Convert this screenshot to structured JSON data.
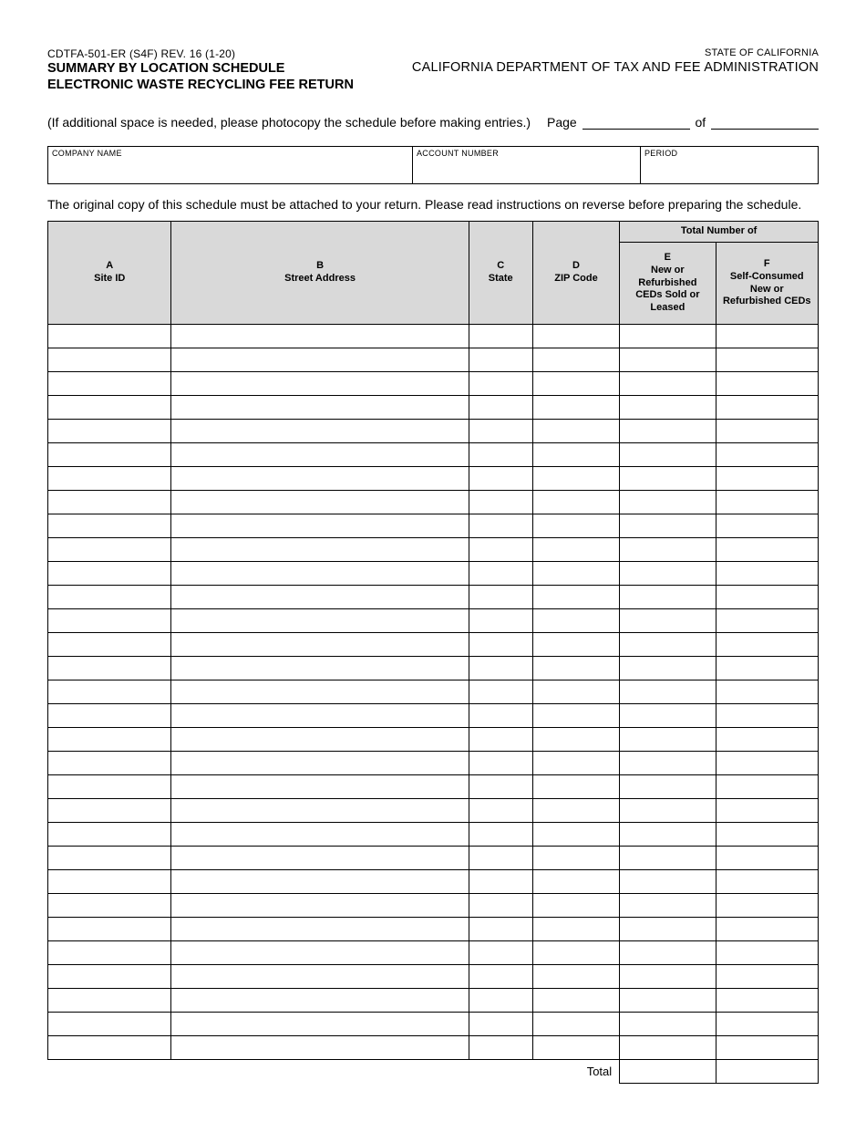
{
  "header": {
    "form_id": "CDTFA-501-ER (S4F) REV. 16 (1-20)",
    "title_line1": "SUMMARY BY LOCATION SCHEDULE",
    "title_line2": "ELECTRONIC WASTE RECYCLING FEE RETURN",
    "state": "STATE OF CALIFORNIA",
    "department": "CALIFORNIA DEPARTMENT OF TAX AND FEE ADMINISTRATION"
  },
  "instructions": {
    "photocopy": "(If additional space is needed, please photocopy the schedule before making entries.)",
    "page_label": "Page",
    "of_label": "of",
    "attach_note": "The original copy of this schedule must be attached to your return. Please read instructions on reverse before preparing the schedule."
  },
  "page_of": {
    "page": "",
    "total": ""
  },
  "info_box": {
    "company_label": "COMPANY NAME",
    "account_label": "ACCOUNT NUMBER",
    "period_label": "PERIOD",
    "company_value": "",
    "account_value": "",
    "period_value": ""
  },
  "schedule": {
    "super_header": "Total Number of",
    "columns": {
      "a": {
        "letter": "A",
        "label": "Site ID"
      },
      "b": {
        "letter": "B",
        "label": "Street Address"
      },
      "c": {
        "letter": "C",
        "label": "State"
      },
      "d": {
        "letter": "D",
        "label": "ZIP Code"
      },
      "e": {
        "letter": "E",
        "label": "New or Refurbished CEDs Sold or Leased"
      },
      "f": {
        "letter": "F",
        "label": "Self-Consumed New or Refurbished CEDs"
      }
    },
    "row_count": 31,
    "total_label": "Total",
    "totals": {
      "e": "",
      "f": ""
    }
  }
}
